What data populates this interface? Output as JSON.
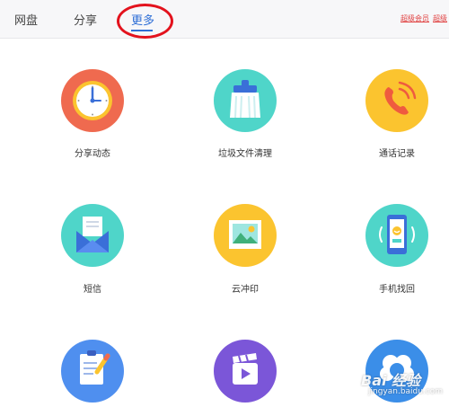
{
  "tabs": [
    {
      "label": "网盘",
      "active": false
    },
    {
      "label": "分享",
      "active": false
    },
    {
      "label": "更多",
      "active": true
    }
  ],
  "header_links": [
    "超级会员",
    "超级"
  ],
  "items": [
    {
      "label": "分享动态",
      "icon": "clock-icon",
      "color": "#ef6a4f"
    },
    {
      "label": "垃圾文件清理",
      "icon": "brush-icon",
      "color": "#4fd5c9"
    },
    {
      "label": "通话记录",
      "icon": "phone-icon",
      "color": "#fbc42f"
    },
    {
      "label": "短信",
      "icon": "envelope-icon",
      "color": "#4fd5c9"
    },
    {
      "label": "云冲印",
      "icon": "picture-icon",
      "color": "#fbc42f"
    },
    {
      "label": "手机找回",
      "icon": "phone-smile-icon",
      "color": "#4fd5c9"
    },
    {
      "label": "",
      "icon": "clipboard-pen-icon",
      "color": "#4f8fef"
    },
    {
      "label": "",
      "icon": "clapperboard-icon",
      "color": "#7b56d8"
    },
    {
      "label": "",
      "icon": "cloud-icon",
      "color": "#3b8ee8"
    }
  ],
  "watermark": {
    "text": "Bai 经验",
    "sub": "jingyan.baidu.com"
  },
  "colors": {
    "active_tab": "#2f6fd6",
    "highlight_ring": "#e3121d",
    "link": "#e04040"
  }
}
